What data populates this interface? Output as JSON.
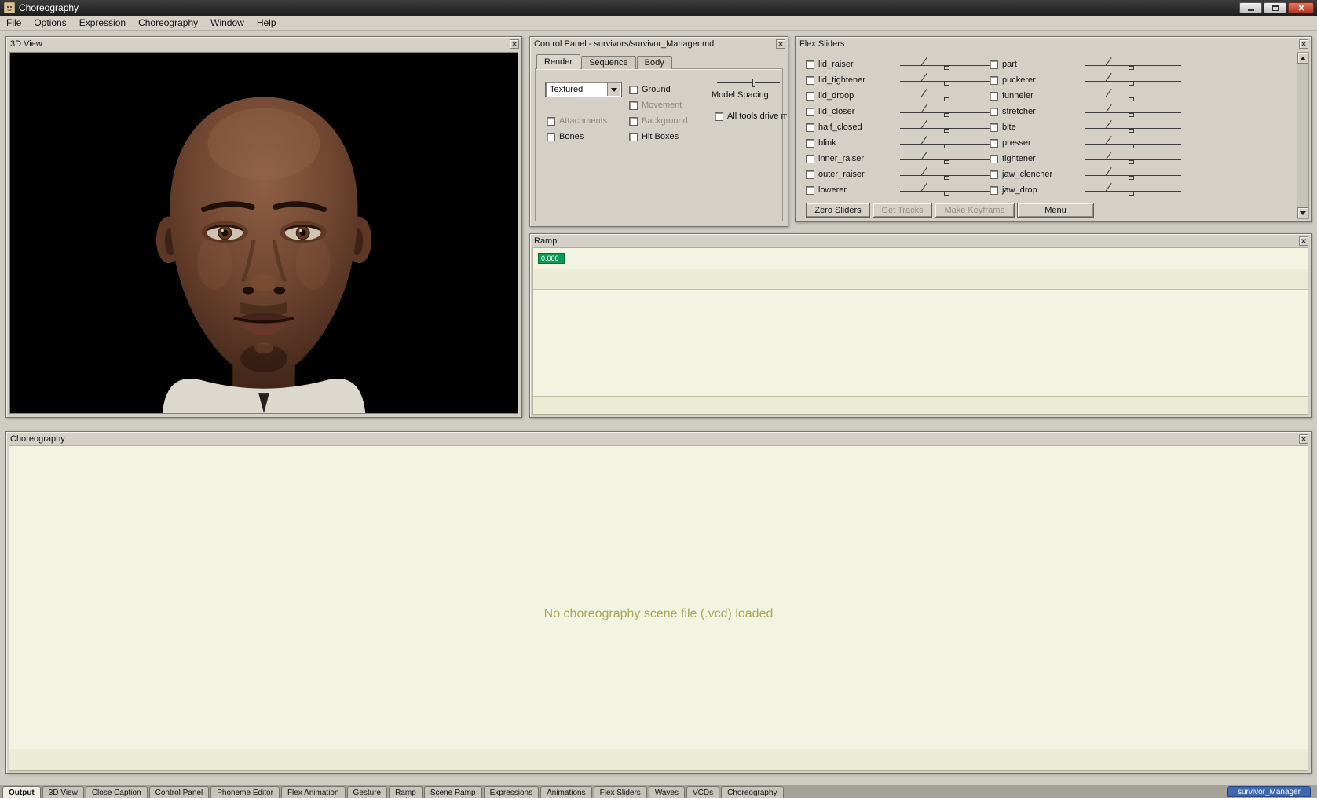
{
  "titlebar": {
    "title": "Choreography"
  },
  "menu": {
    "items": [
      "File",
      "Options",
      "Expression",
      "Choreography",
      "Window",
      "Help"
    ]
  },
  "view3d": {
    "title": "3D View"
  },
  "control": {
    "title": "Control Panel - survivors/survivor_Manager.mdl",
    "tabs": [
      "Render",
      "Sequence",
      "Body"
    ],
    "render_mode": "Textured",
    "checks": {
      "ground": "Ground",
      "movement": "Movement",
      "attachments": "Attachments",
      "background": "Background",
      "bones": "Bones",
      "hitboxes": "Hit Boxes",
      "alltools": "All tools drive m"
    },
    "model_spacing": "Model Spacing"
  },
  "flex": {
    "title": "Flex Sliders",
    "left": [
      "lid_raiser",
      "lid_tightener",
      "lid_droop",
      "lid_closer",
      "half_closed",
      "blink",
      "inner_raiser",
      "outer_raiser",
      "lowerer"
    ],
    "right": [
      "part",
      "puckerer",
      "funneler",
      "stretcher",
      "bite",
      "presser",
      "tightener",
      "jaw_clencher",
      "jaw_drop"
    ],
    "buttons": [
      "Zero Sliders",
      "Get Tracks",
      "Make Keyframe",
      "Menu"
    ]
  },
  "ramp": {
    "title": "Ramp",
    "time_badge": "0.000"
  },
  "choreo": {
    "title": "Choreography",
    "empty_message": "No choreography scene file (.vcd) loaded"
  },
  "tabbar": {
    "tabs": [
      "Output",
      "3D View",
      "Close Caption",
      "Control Panel",
      "Phoneme Editor",
      "Flex Animation",
      "Gesture",
      "Ramp",
      "Scene Ramp",
      "Expressions",
      "Animations",
      "Flex Sliders",
      "Waves",
      "VCDs",
      "Choreography"
    ],
    "active": "Output",
    "model_tab": "survivor_Manager"
  },
  "colors": {
    "accent_green": "#0c9b57",
    "selection_blue": "#3f68b4",
    "close_red": "#b03a28",
    "pale_workspace": "#f3f3e1",
    "olive_text": "#a9a95a"
  }
}
